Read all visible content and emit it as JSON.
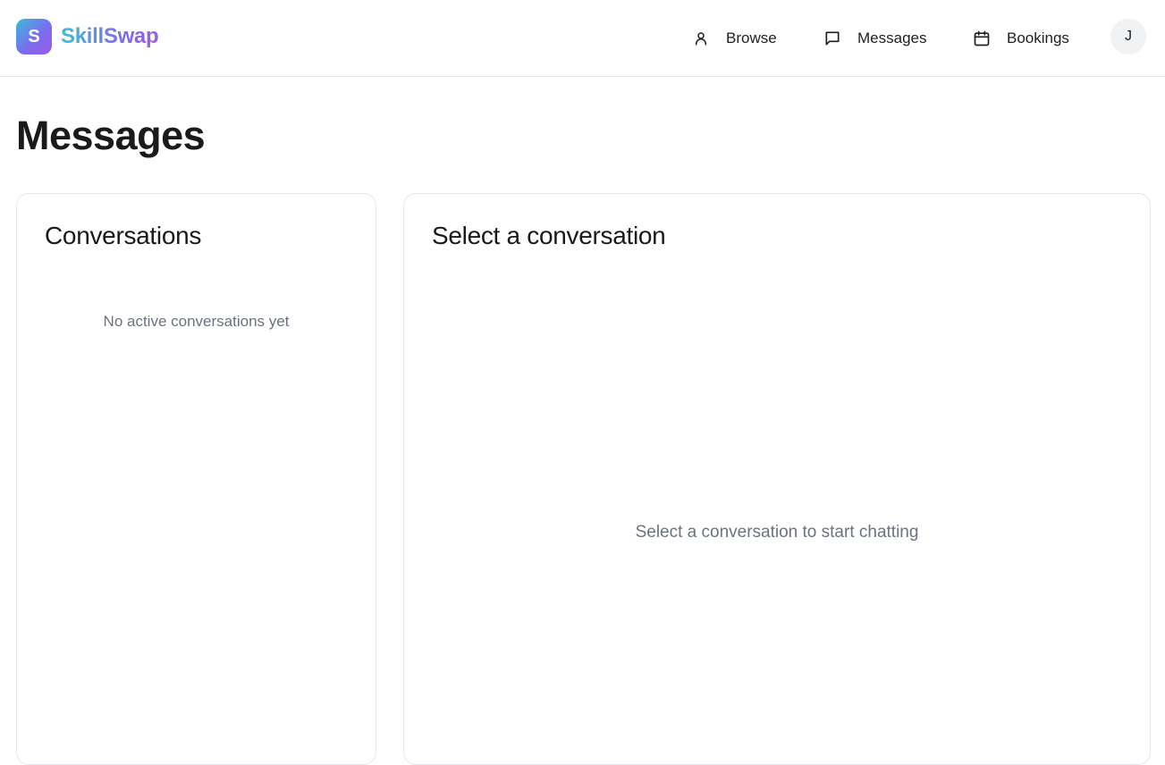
{
  "brand": {
    "logo_letter": "S",
    "name": "SkillSwap",
    "gradient_start": "#38bdd6",
    "gradient_end": "#9a5ce8"
  },
  "nav": {
    "items": [
      {
        "label": "Browse",
        "icon": "user-icon"
      },
      {
        "label": "Messages",
        "icon": "chat-bubble-icon"
      },
      {
        "label": "Bookings",
        "icon": "calendar-icon"
      }
    ],
    "avatar_initial": "J"
  },
  "page": {
    "title": "Messages"
  },
  "conversations_panel": {
    "title": "Conversations",
    "empty_text": "No active conversations yet"
  },
  "chat_panel": {
    "title": "Select a conversation",
    "empty_text": "Select a conversation to start chatting"
  },
  "colors": {
    "border": "#e5e7eb",
    "muted_text": "#6b7280",
    "text": "#1a1a1a",
    "avatar_bg": "#f1f2f4"
  }
}
